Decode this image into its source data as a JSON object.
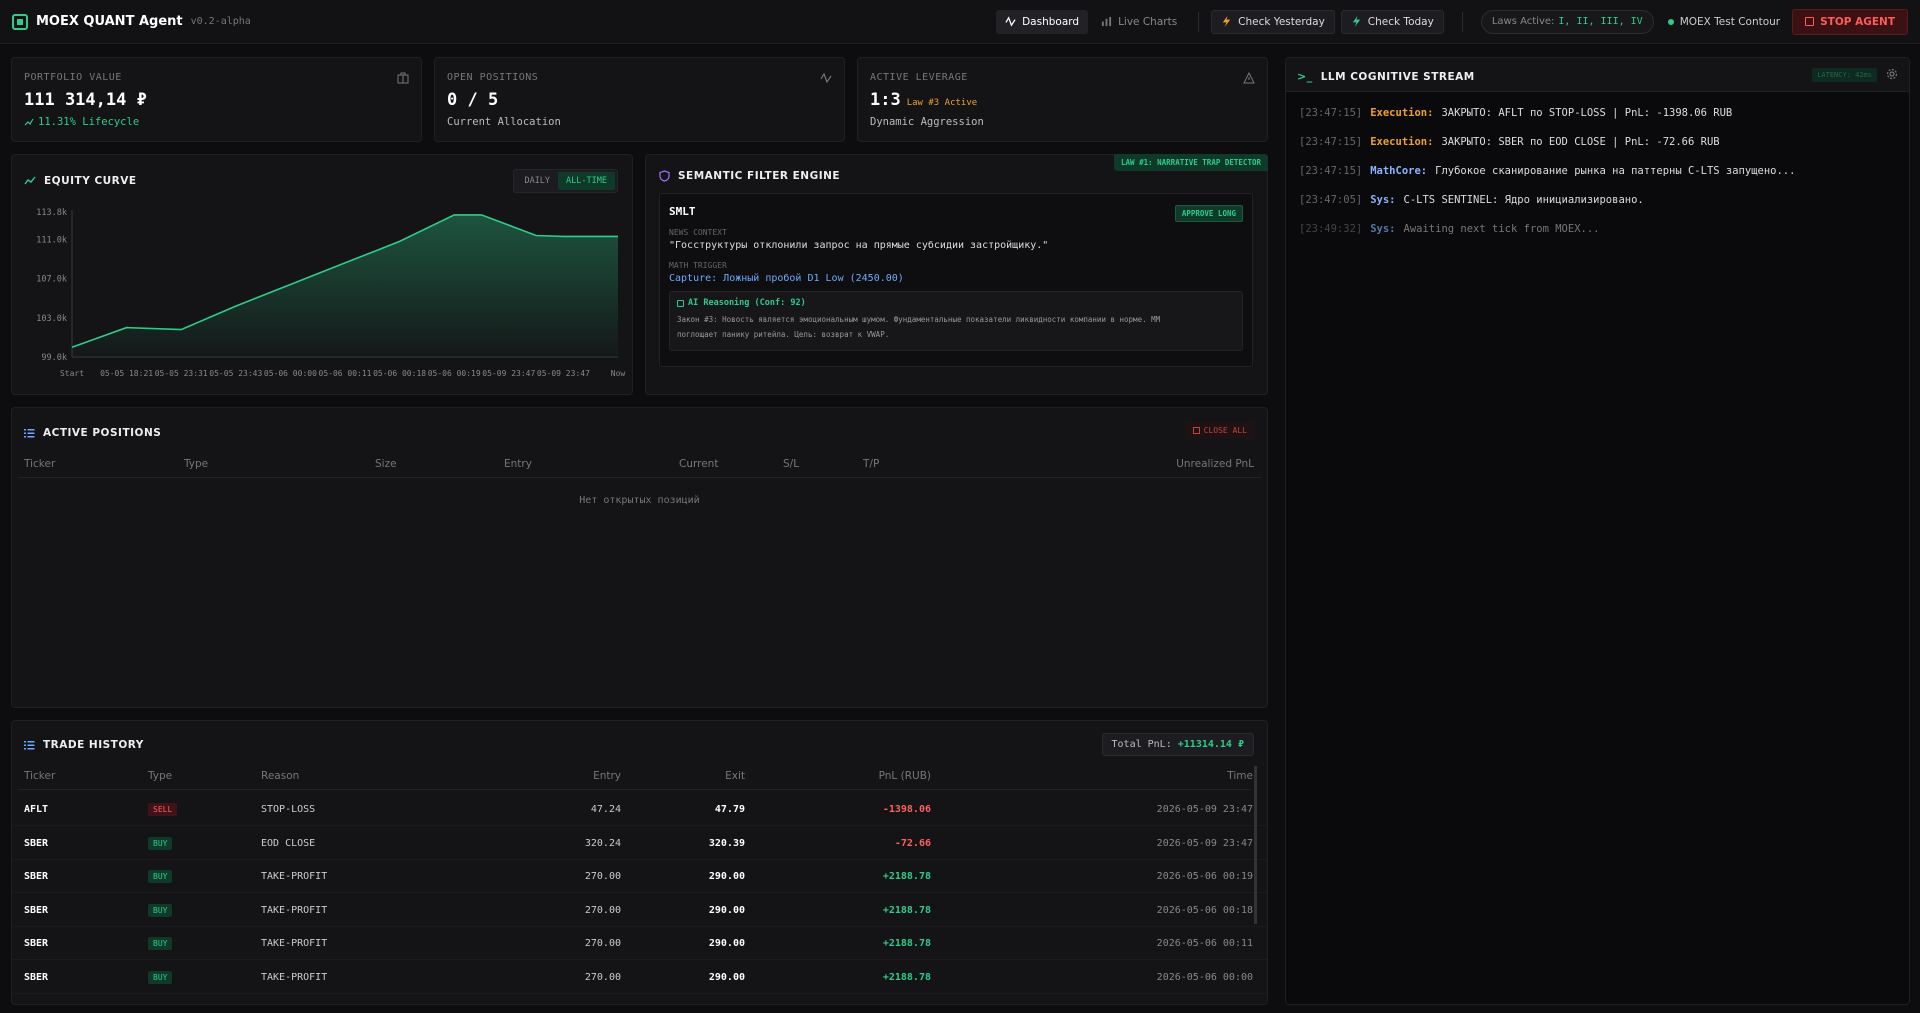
{
  "header": {
    "title": "MOEX QUANT Agent",
    "version": "v0.2-alpha",
    "nav": [
      "Dashboard",
      "Live Charts"
    ],
    "check_yesterday": "Check Yesterday",
    "check_today": "Check Today",
    "laws_label": "Laws Active:",
    "laws_value": "I, II, III, IV",
    "contour": "MOEX Test Contour",
    "stop": "STOP AGENT",
    "colors": {
      "accent": "#2ecc8a",
      "danger": "#ff5c5c",
      "warning": "#f0a030"
    }
  },
  "stats": {
    "portfolio": {
      "label": "PORTFOLIO VALUE",
      "value": "111 314,14 ₽",
      "sub": "11.31% Lifecycle"
    },
    "positions": {
      "label": "OPEN POSITIONS",
      "value": "0 / 5",
      "sub": "Current Allocation"
    },
    "leverage": {
      "label": "ACTIVE LEVERAGE",
      "value": "1:3",
      "tag": "Law #3 Active",
      "sub": "Dynamic Aggression"
    }
  },
  "equity": {
    "title": "EQUITY CURVE",
    "toggle": [
      "DAILY",
      "ALL-TIME"
    ]
  },
  "chart_data": {
    "type": "area",
    "title": "EQUITY CURVE",
    "categories": [
      "Start",
      "05-05 18:21",
      "05-05 23:31",
      "05-05 23:43",
      "05-06 00:00",
      "05-06 00:11",
      "05-06 00:18",
      "05-06 00:19",
      "05-09 23:47",
      "05-09 23:47",
      "Now"
    ],
    "y_ticks": [
      "113.8k",
      "111.0k",
      "107.0k",
      "103.0k",
      "99.0k"
    ],
    "x": [
      0,
      0.1,
      0.2,
      0.3,
      0.4,
      0.5,
      0.6,
      0.7,
      0.75,
      0.85,
      0.9,
      1.0
    ],
    "values": [
      100000,
      102000,
      101800,
      104200,
      106400,
      108600,
      110800,
      113500,
      113500,
      111400,
      111314,
      111314
    ],
    "ylim": [
      99000,
      113800
    ],
    "grid": false
  },
  "semantic": {
    "title": "SEMANTIC FILTER ENGINE",
    "law_tag": "LAW #1: NARRATIVE TRAP DETECTOR",
    "ticker": "SMLT",
    "badge": "APPROVE LONG",
    "news_label": "NEWS CONTEXT",
    "news": "\"Госструктуры отклонили запрос на прямые субсидии застройщику.\"",
    "trigger_label": "MATH TRIGGER",
    "trigger": "Capture: Ложный пробой D1 Low (2450.00)",
    "reasoning_title": "AI Reasoning (Conf: 92)",
    "reasoning_1": "Закон #3: Новость является эмоциональным шумом. Фундаментальные показатели ликвидности компании в норме. ММ",
    "reasoning_2": "поглощает панику ритейла. Цель: возврат к VWAP."
  },
  "active_positions": {
    "title": "ACTIVE POSITIONS",
    "close_all": "CLOSE ALL",
    "columns": [
      "Ticker",
      "Type",
      "Size",
      "Entry",
      "Current",
      "S/L",
      "T/P",
      "Unrealized PnL"
    ],
    "empty": "Нет открытых позиций"
  },
  "trade_history": {
    "title": "TRADE HISTORY",
    "total_label": "Total PnL:",
    "total_value": "+11314.14 ₽",
    "columns": [
      "Ticker",
      "Type",
      "Reason",
      "Entry",
      "Exit",
      "PnL (RUB)",
      "Time"
    ],
    "rows": [
      {
        "ticker": "AFLT",
        "type": "SELL",
        "reason": "STOP-LOSS",
        "entry": "47.24",
        "exit": "47.79",
        "pnl": "-1398.06",
        "time": "2026-05-09 23:47"
      },
      {
        "ticker": "SBER",
        "type": "BUY",
        "reason": "EOD CLOSE",
        "entry": "320.24",
        "exit": "320.39",
        "pnl": "-72.66",
        "time": "2026-05-09 23:47"
      },
      {
        "ticker": "SBER",
        "type": "BUY",
        "reason": "TAKE-PROFIT",
        "entry": "270.00",
        "exit": "290.00",
        "pnl": "+2188.78",
        "time": "2026-05-06 00:19"
      },
      {
        "ticker": "SBER",
        "type": "BUY",
        "reason": "TAKE-PROFIT",
        "entry": "270.00",
        "exit": "290.00",
        "pnl": "+2188.78",
        "time": "2026-05-06 00:18"
      },
      {
        "ticker": "SBER",
        "type": "BUY",
        "reason": "TAKE-PROFIT",
        "entry": "270.00",
        "exit": "290.00",
        "pnl": "+2188.78",
        "time": "2026-05-06 00:11"
      },
      {
        "ticker": "SBER",
        "type": "BUY",
        "reason": "TAKE-PROFIT",
        "entry": "270.00",
        "exit": "290.00",
        "pnl": "+2188.78",
        "time": "2026-05-06 00:00"
      }
    ]
  },
  "stream": {
    "title": "LLM COGNITIVE STREAM",
    "latency": "LATENCY: 42ms",
    "lines": [
      {
        "time": "[23:47:15]",
        "src": "Execution:",
        "text": "ЗАКРЫТО: AFLT по STOP-LOSS | PnL: -1398.06 RUB",
        "color": "#f0a030"
      },
      {
        "time": "[23:47:15]",
        "src": "Execution:",
        "text": "ЗАКРЫТО: SBER по EOD CLOSE | PnL: -72.66 RUB",
        "color": "#f0a030"
      },
      {
        "time": "[23:47:15]",
        "src": "MathCore:",
        "text": "Глубокое сканирование рынка на паттерны C-LTS запущено...",
        "color": "#8ab4ff"
      },
      {
        "time": "[23:47:05]",
        "src": "Sys:",
        "text": "C-LTS SENTINEL: Ядро инициализировано.",
        "color": "#8ab4ff"
      },
      {
        "time": "[23:49:32]",
        "src": "Sys:",
        "text": "Awaiting next tick from MOEX...",
        "color": "#5577aa"
      }
    ]
  }
}
